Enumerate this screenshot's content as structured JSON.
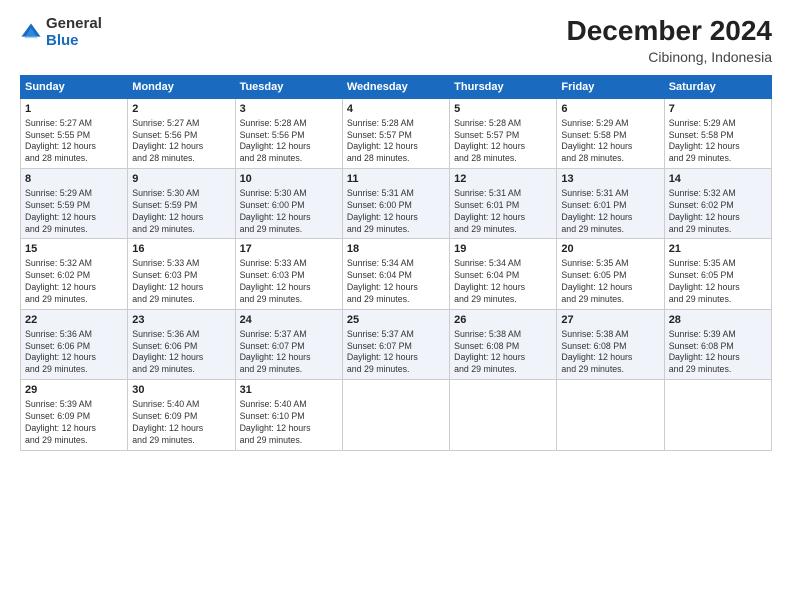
{
  "logo": {
    "general": "General",
    "blue": "Blue"
  },
  "title": "December 2024",
  "subtitle": "Cibinong, Indonesia",
  "days_of_week": [
    "Sunday",
    "Monday",
    "Tuesday",
    "Wednesday",
    "Thursday",
    "Friday",
    "Saturday"
  ],
  "weeks": [
    [
      {
        "day": "1",
        "sunrise": "5:27 AM",
        "sunset": "5:55 PM",
        "daylight": "12 hours and 28 minutes."
      },
      {
        "day": "2",
        "sunrise": "5:27 AM",
        "sunset": "5:56 PM",
        "daylight": "12 hours and 28 minutes."
      },
      {
        "day": "3",
        "sunrise": "5:28 AM",
        "sunset": "5:56 PM",
        "daylight": "12 hours and 28 minutes."
      },
      {
        "day": "4",
        "sunrise": "5:28 AM",
        "sunset": "5:57 PM",
        "daylight": "12 hours and 28 minutes."
      },
      {
        "day": "5",
        "sunrise": "5:28 AM",
        "sunset": "5:57 PM",
        "daylight": "12 hours and 28 minutes."
      },
      {
        "day": "6",
        "sunrise": "5:29 AM",
        "sunset": "5:58 PM",
        "daylight": "12 hours and 28 minutes."
      },
      {
        "day": "7",
        "sunrise": "5:29 AM",
        "sunset": "5:58 PM",
        "daylight": "12 hours and 29 minutes."
      }
    ],
    [
      {
        "day": "8",
        "sunrise": "5:29 AM",
        "sunset": "5:59 PM",
        "daylight": "12 hours and 29 minutes."
      },
      {
        "day": "9",
        "sunrise": "5:30 AM",
        "sunset": "5:59 PM",
        "daylight": "12 hours and 29 minutes."
      },
      {
        "day": "10",
        "sunrise": "5:30 AM",
        "sunset": "6:00 PM",
        "daylight": "12 hours and 29 minutes."
      },
      {
        "day": "11",
        "sunrise": "5:31 AM",
        "sunset": "6:00 PM",
        "daylight": "12 hours and 29 minutes."
      },
      {
        "day": "12",
        "sunrise": "5:31 AM",
        "sunset": "6:01 PM",
        "daylight": "12 hours and 29 minutes."
      },
      {
        "day": "13",
        "sunrise": "5:31 AM",
        "sunset": "6:01 PM",
        "daylight": "12 hours and 29 minutes."
      },
      {
        "day": "14",
        "sunrise": "5:32 AM",
        "sunset": "6:02 PM",
        "daylight": "12 hours and 29 minutes."
      }
    ],
    [
      {
        "day": "15",
        "sunrise": "5:32 AM",
        "sunset": "6:02 PM",
        "daylight": "12 hours and 29 minutes."
      },
      {
        "day": "16",
        "sunrise": "5:33 AM",
        "sunset": "6:03 PM",
        "daylight": "12 hours and 29 minutes."
      },
      {
        "day": "17",
        "sunrise": "5:33 AM",
        "sunset": "6:03 PM",
        "daylight": "12 hours and 29 minutes."
      },
      {
        "day": "18",
        "sunrise": "5:34 AM",
        "sunset": "6:04 PM",
        "daylight": "12 hours and 29 minutes."
      },
      {
        "day": "19",
        "sunrise": "5:34 AM",
        "sunset": "6:04 PM",
        "daylight": "12 hours and 29 minutes."
      },
      {
        "day": "20",
        "sunrise": "5:35 AM",
        "sunset": "6:05 PM",
        "daylight": "12 hours and 29 minutes."
      },
      {
        "day": "21",
        "sunrise": "5:35 AM",
        "sunset": "6:05 PM",
        "daylight": "12 hours and 29 minutes."
      }
    ],
    [
      {
        "day": "22",
        "sunrise": "5:36 AM",
        "sunset": "6:06 PM",
        "daylight": "12 hours and 29 minutes."
      },
      {
        "day": "23",
        "sunrise": "5:36 AM",
        "sunset": "6:06 PM",
        "daylight": "12 hours and 29 minutes."
      },
      {
        "day": "24",
        "sunrise": "5:37 AM",
        "sunset": "6:07 PM",
        "daylight": "12 hours and 29 minutes."
      },
      {
        "day": "25",
        "sunrise": "5:37 AM",
        "sunset": "6:07 PM",
        "daylight": "12 hours and 29 minutes."
      },
      {
        "day": "26",
        "sunrise": "5:38 AM",
        "sunset": "6:08 PM",
        "daylight": "12 hours and 29 minutes."
      },
      {
        "day": "27",
        "sunrise": "5:38 AM",
        "sunset": "6:08 PM",
        "daylight": "12 hours and 29 minutes."
      },
      {
        "day": "28",
        "sunrise": "5:39 AM",
        "sunset": "6:08 PM",
        "daylight": "12 hours and 29 minutes."
      }
    ],
    [
      {
        "day": "29",
        "sunrise": "5:39 AM",
        "sunset": "6:09 PM",
        "daylight": "12 hours and 29 minutes."
      },
      {
        "day": "30",
        "sunrise": "5:40 AM",
        "sunset": "6:09 PM",
        "daylight": "12 hours and 29 minutes."
      },
      {
        "day": "31",
        "sunrise": "5:40 AM",
        "sunset": "6:10 PM",
        "daylight": "12 hours and 29 minutes."
      },
      null,
      null,
      null,
      null
    ]
  ],
  "labels": {
    "sunrise": "Sunrise:",
    "sunset": "Sunset:",
    "daylight": "Daylight:"
  }
}
